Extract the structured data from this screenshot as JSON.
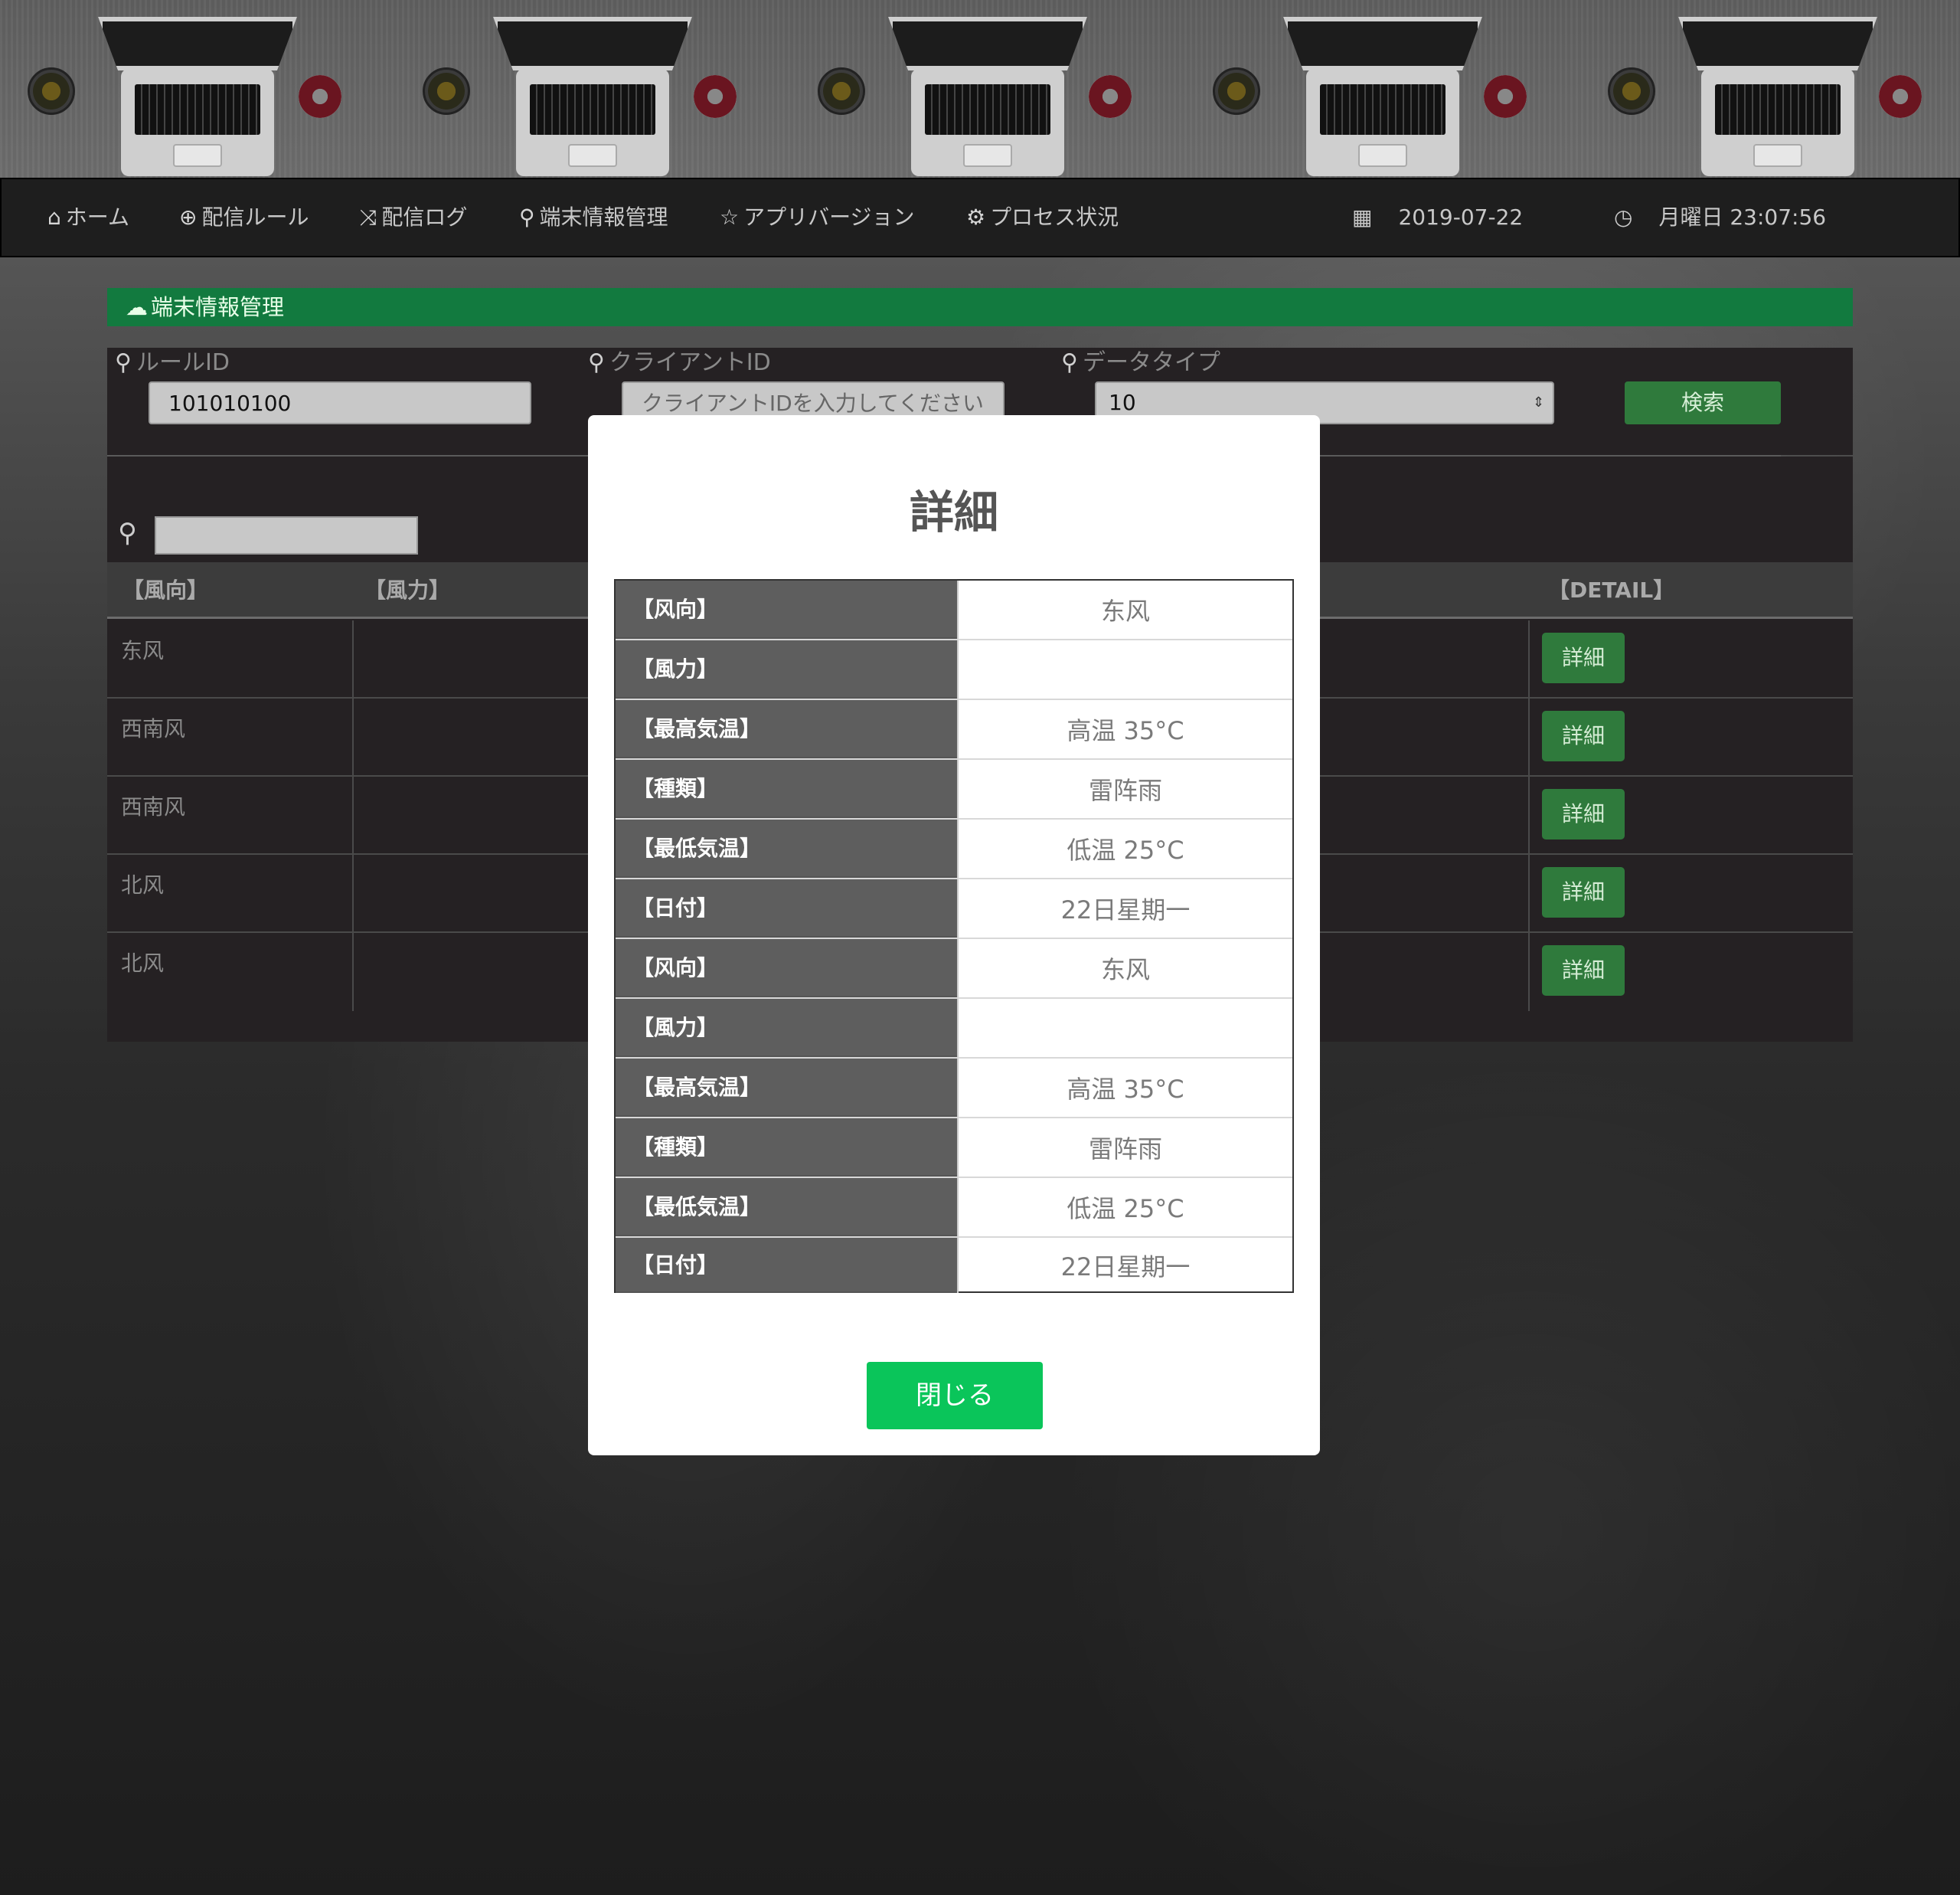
{
  "nav": {
    "home": "ホーム",
    "delivery_rule": "配信ルール",
    "delivery_log": "配信ログ",
    "device_info": "端末情報管理",
    "app_version": "アプリバージョン",
    "process_status": "プロセス状況",
    "date": "2019-07-22",
    "time": "月曜日 23:07:56"
  },
  "panel": {
    "title": "端末情報管理",
    "header_color": "#127a3f"
  },
  "search": {
    "rule_id_label": "ルールID",
    "rule_id_value": "101010100",
    "client_id_label": "クライアントID",
    "client_id_placeholder": "クライアントIDを入力してください",
    "data_type_label": "データタイプ",
    "data_type_value": "10",
    "search_button": "検索"
  },
  "table": {
    "headers": {
      "wind_direction": "【風向】",
      "wind_power": "【風力】",
      "detail": "【DETAIL】"
    },
    "rows": [
      {
        "wind_direction": "东风",
        "detail": "詳細"
      },
      {
        "wind_direction": "西南风",
        "detail": "詳細"
      },
      {
        "wind_direction": "西南风",
        "detail": "詳細"
      },
      {
        "wind_direction": "北风",
        "detail": "詳細"
      },
      {
        "wind_direction": "北风",
        "detail": "詳細"
      }
    ]
  },
  "modal": {
    "title": "詳細",
    "rows": [
      {
        "key": "【风向】",
        "value": "东风"
      },
      {
        "key": "【風力】",
        "value": ""
      },
      {
        "key": "【最高気温】",
        "value": "高温 35°C"
      },
      {
        "key": "【種類】",
        "value": "雷阵雨"
      },
      {
        "key": "【最低気温】",
        "value": "低温 25°C"
      },
      {
        "key": "【日付】",
        "value": "22日星期一"
      },
      {
        "key": "【风向】",
        "value": "东风"
      },
      {
        "key": "【風力】",
        "value": ""
      },
      {
        "key": "【最高気温】",
        "value": "高温 35°C"
      },
      {
        "key": "【種類】",
        "value": "雷阵雨"
      },
      {
        "key": "【最低気温】",
        "value": "低温 25°C"
      },
      {
        "key": "【日付】",
        "value": "22日星期一"
      }
    ],
    "close_button": "閉じる",
    "close_button_color": "#0ac55a"
  },
  "icons": {
    "home": "home-icon",
    "delivery_rule": "zoom-icon",
    "delivery_log": "shuffle-icon",
    "device_info": "search-icon",
    "app_version": "star-icon",
    "process_status": "gear-icon",
    "date": "calendar-icon",
    "time": "clock-icon",
    "panel": "cloud-icon"
  }
}
